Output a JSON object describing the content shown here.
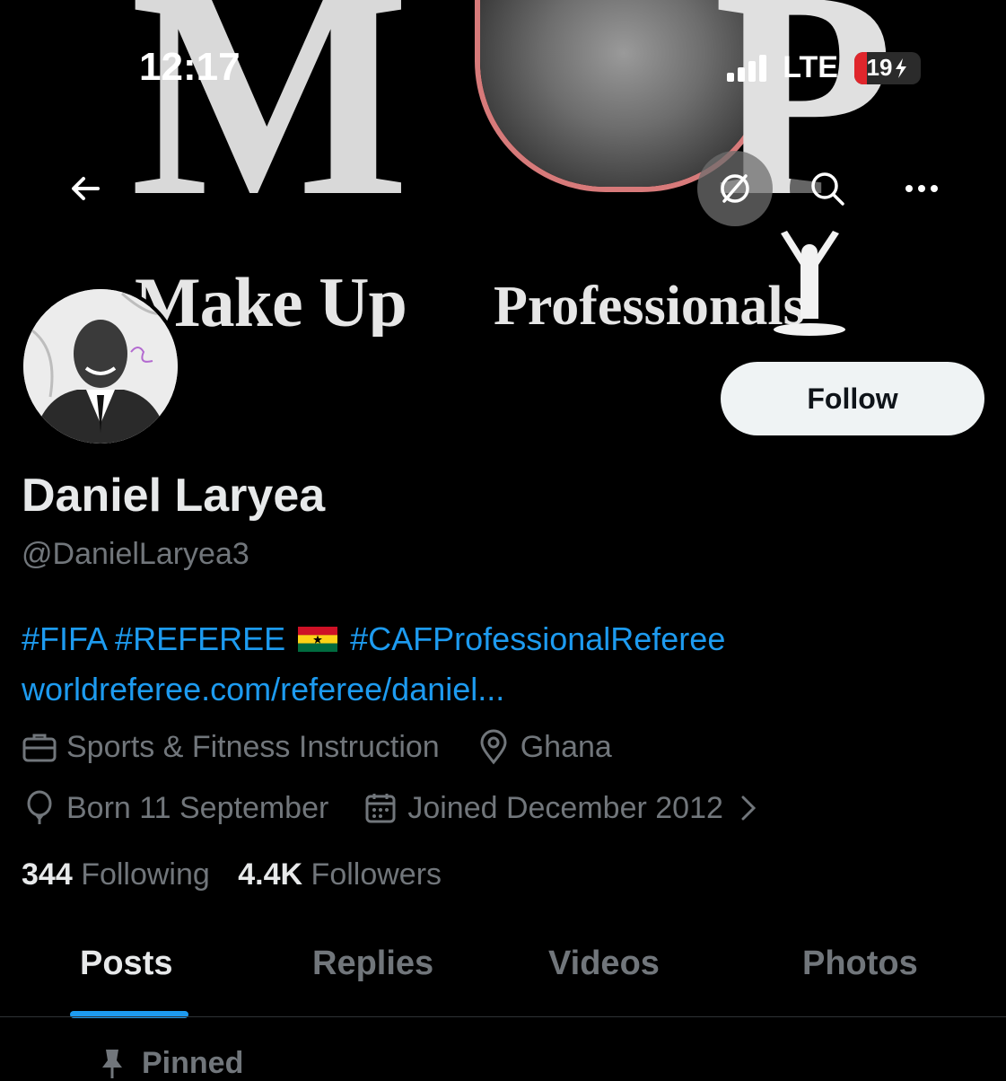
{
  "status_bar": {
    "time": "12:17",
    "network": "LTE",
    "battery": "19"
  },
  "banner": {
    "letter_m": "M",
    "letter_p": "P",
    "brand_part1": "Make Up",
    "brand_part2": "Professionals"
  },
  "header": {
    "back_icon": "arrow-left-icon",
    "grok_icon": "slash-circle-icon",
    "search_icon": "search-icon",
    "more_icon": "more-horizontal-icon"
  },
  "profile": {
    "name": "Daniel Laryea",
    "handle": "@DanielLaryea3",
    "follow_label": "Follow",
    "bio_tags_1": "#FIFA #REFEREE",
    "bio_tags_2": "#CAFProfessionalReferee",
    "website": "worldreferee.com/referee/daniel...",
    "category": "Sports & Fitness Instruction",
    "location": "Ghana",
    "birthday": "Born 11 September",
    "joined": "Joined December 2012",
    "following_count": "344",
    "following_label": "Following",
    "followers_count": "4.4K",
    "followers_label": "Followers"
  },
  "tabs": [
    {
      "label": "Posts",
      "active": true
    },
    {
      "label": "Replies",
      "active": false
    },
    {
      "label": "Videos",
      "active": false
    },
    {
      "label": "Photos",
      "active": false
    }
  ],
  "pinned_label": "Pinned",
  "colors": {
    "accent": "#1d9bf0",
    "muted": "#71767b",
    "background": "#000000"
  }
}
